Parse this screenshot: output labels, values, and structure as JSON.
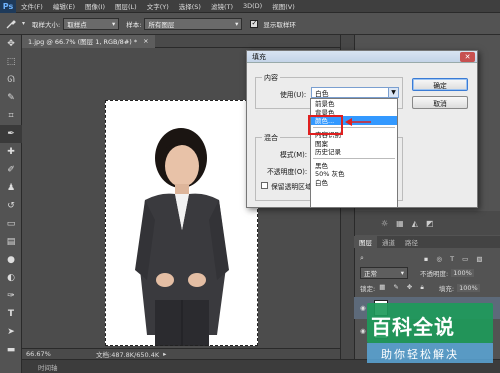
{
  "app": {
    "logo": "Ps"
  },
  "menu": [
    "文件(F)",
    "编辑(E)",
    "图像(I)",
    "图层(L)",
    "文字(Y)",
    "选择(S)",
    "滤镜(T)",
    "3D(D)",
    "视图(V)"
  ],
  "options_bar": {
    "sample_size_label": "取样大小:",
    "sample_size_value": "取样点",
    "sample_label": "样本:",
    "sample_value": "所有图层",
    "show_ring_label": "显示取样环"
  },
  "document": {
    "tab_title": "1.jpg @ 66.7% (图层 1, RGB/8#) *",
    "close": "×"
  },
  "status_bar": {
    "zoom": "66.67%",
    "doc_info": "文档:487.8K/650.4K"
  },
  "timeline": {
    "label": "时间轴"
  },
  "layers_panel": {
    "tabs": [
      "图层",
      "通道",
      "路径"
    ],
    "blend_mode": "正常",
    "opacity_label": "不透明度:",
    "opacity_value": "100%",
    "lock_label": "锁定:",
    "fill_label": "填充:",
    "fill_value": "100%"
  },
  "dialog": {
    "title": "填充",
    "close": "✕",
    "content_group": "内容",
    "use_label": "使用(U):",
    "use_value": "白色",
    "blend_group": "混合",
    "mode_label": "模式(M):",
    "opacity_label": "不透明度(O):",
    "preserve_label": "保留透明区域",
    "ok": "确定",
    "cancel": "取消"
  },
  "dropdown": {
    "items_top": [
      "前景色",
      "背景色",
      "颜色..."
    ],
    "items_mid": [
      "内容识别",
      "图案",
      "历史记录"
    ],
    "items_bottom": [
      "黑色",
      "50% 灰色",
      "白色"
    ],
    "selected": "颜色..."
  },
  "watermark": {
    "title": "百科全说",
    "subtitle": "助你轻松解决"
  },
  "colors": {
    "accent_red": "#e02020",
    "selection_blue": "#3399ff",
    "ps_blue": "#1e3a5a"
  }
}
